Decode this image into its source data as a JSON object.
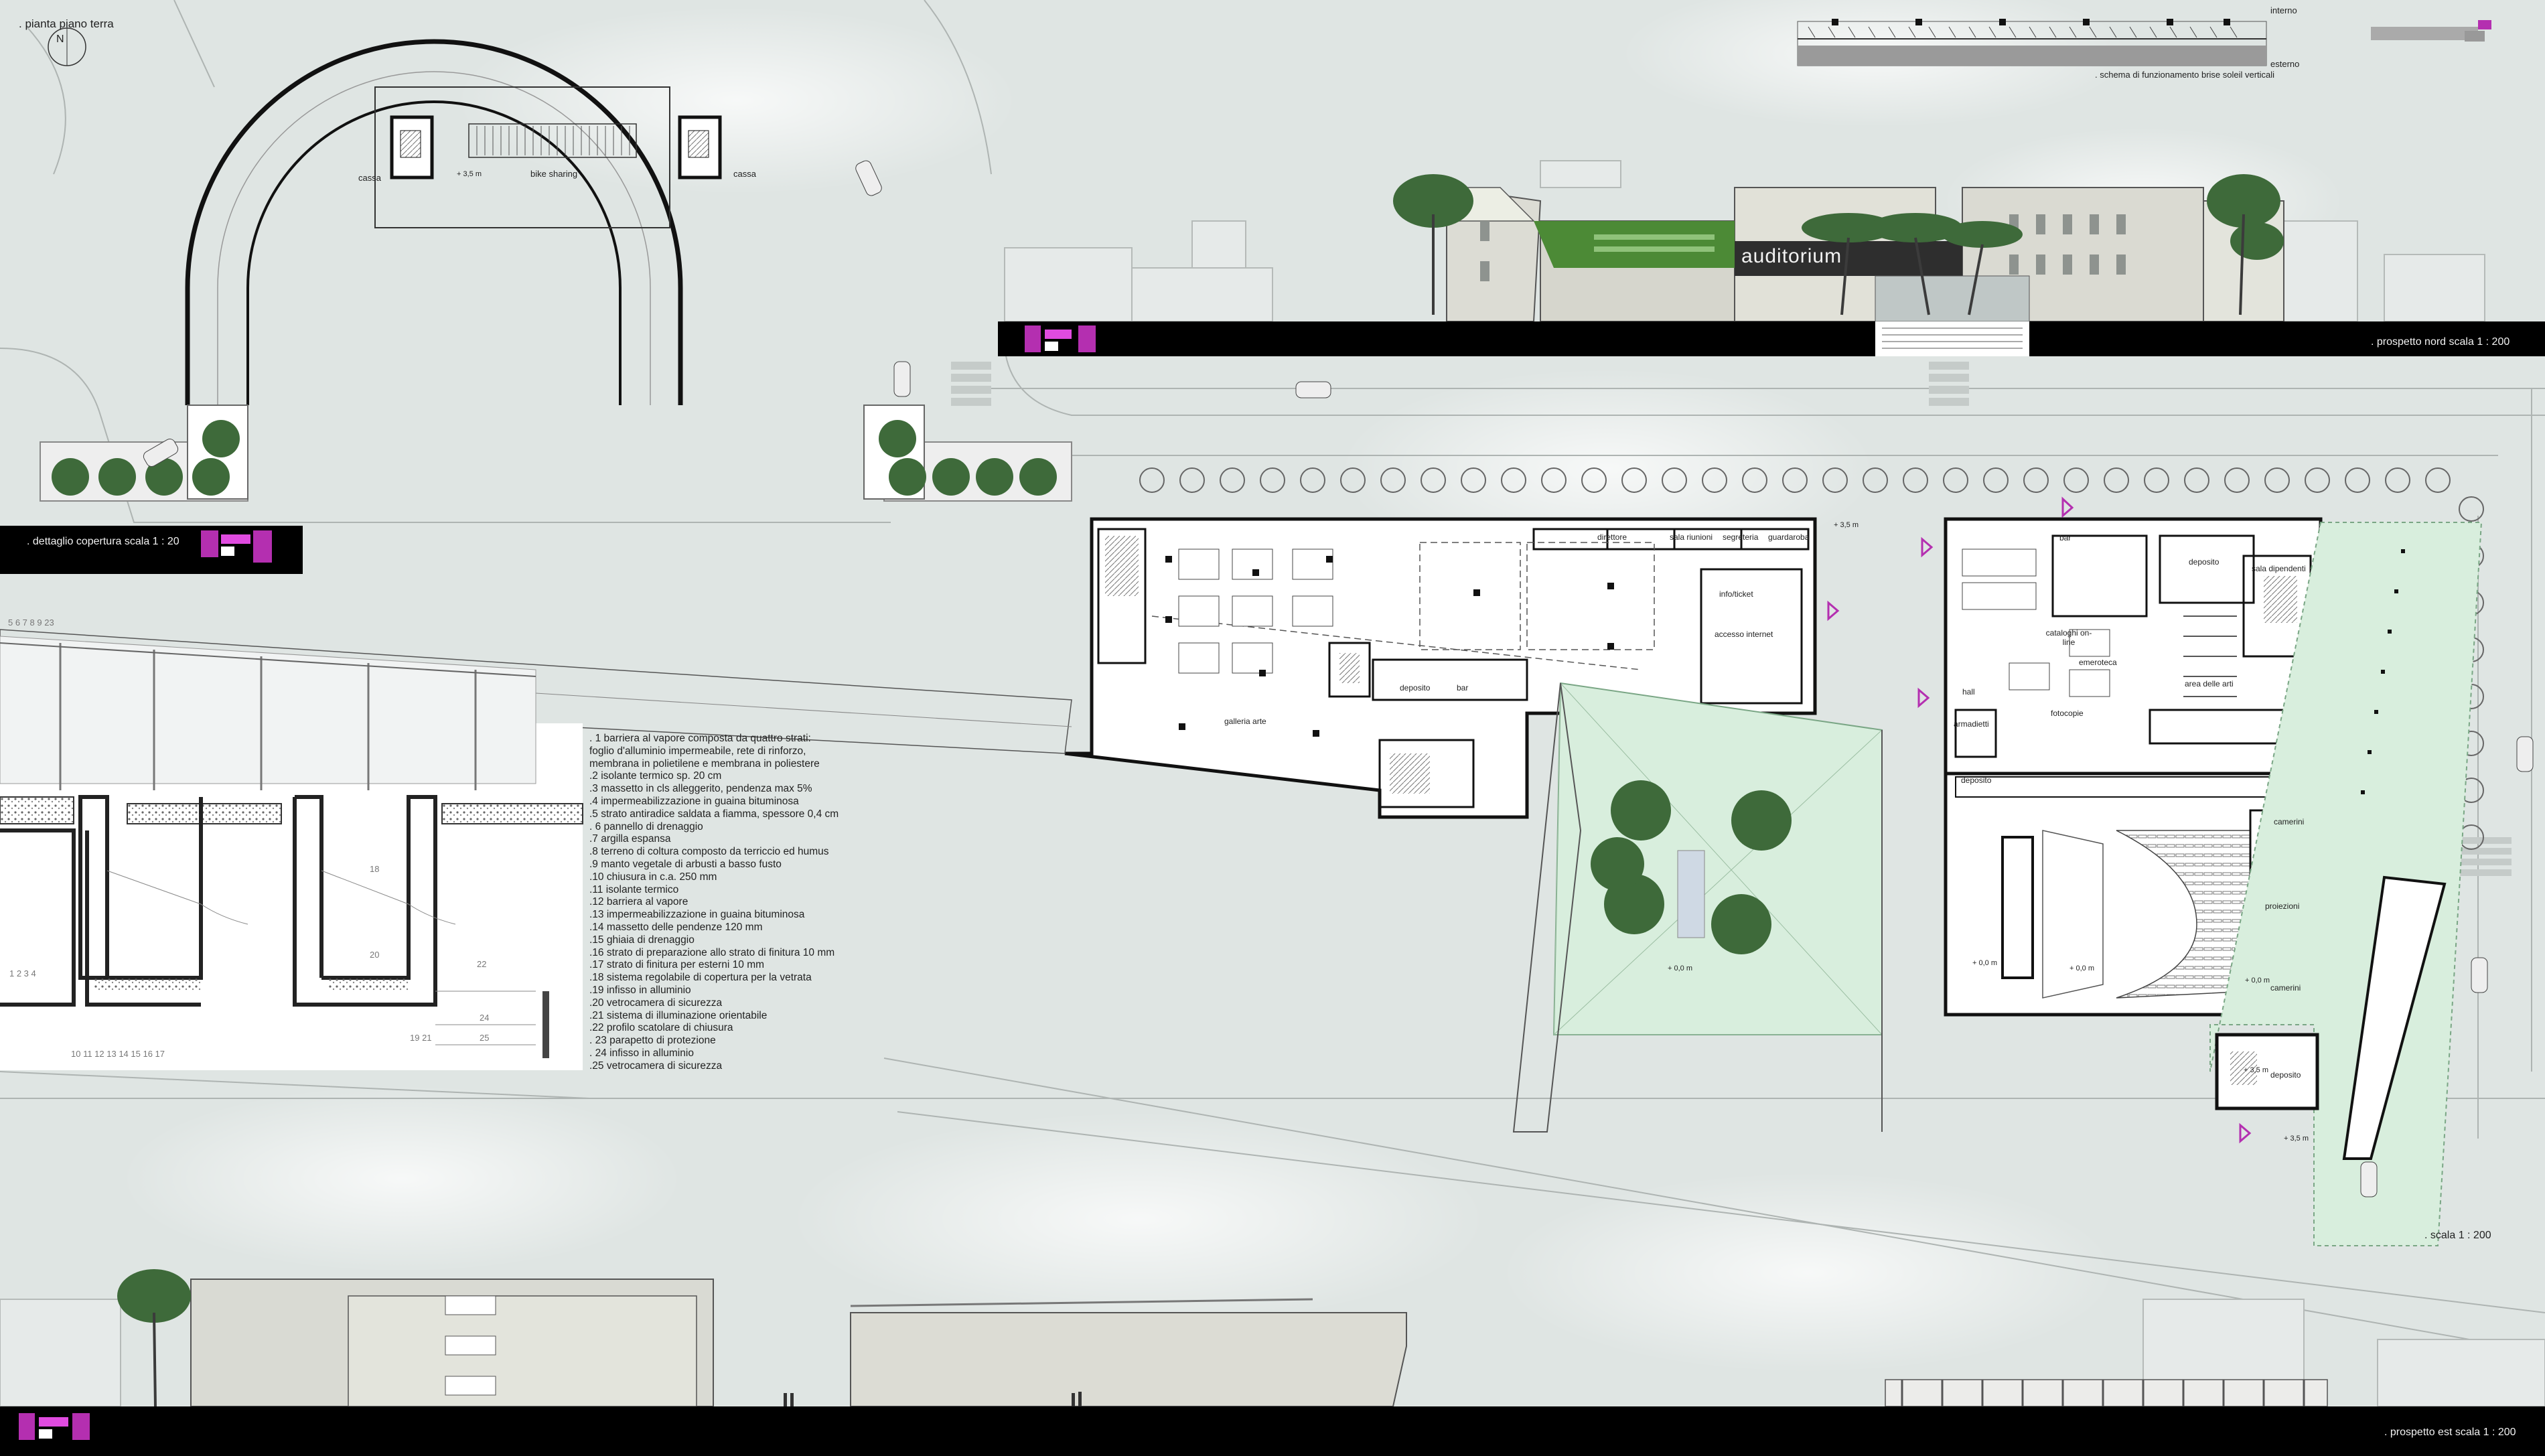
{
  "title": {
    "ground_floor_plan": ". pianta piano terra",
    "north_arrow": "N"
  },
  "scales": {
    "north_elevation": ". prospetto nord scala 1 : 200",
    "roof_detail": ". dettaglio copertura scala 1 : 20",
    "plan_scale": ". scala 1 : 200",
    "east_elevation": ". prospetto est scala 1 : 200"
  },
  "brise_soleil_schema": {
    "interior": "interno",
    "exterior": "esterno",
    "caption": ". schema di funzionamento brise soleil verticali"
  },
  "elevation_north": {
    "auditorium_sign": "auditorium"
  },
  "arch_pavilion": {
    "cassa_left": "cassa",
    "cassa_right": "cassa",
    "bike_sharing": "bike sharing",
    "level": "+ 3,5 m"
  },
  "rooms": {
    "direttore": "direttore",
    "sala_riunioni": "sala riunioni",
    "segreteria": "segreteria",
    "guardaroba": "guardaroba",
    "info_ticket": "info/ticket",
    "accesso_internet": "accesso internet",
    "galleria_arte": "galleria arte",
    "deposito_west": "deposito",
    "bar_west": "bar",
    "bar_east": "bar",
    "deposito_ne": "deposito",
    "sala_dipendenti": "sala dipendenti",
    "cataloghi": "cataloghi on-line",
    "emeroteca": "emeroteca",
    "area_arti": "area delle arti",
    "hall": "hall",
    "armadietti": "armadietti",
    "fotocopie": "fotocopie",
    "deposito_aud": "deposito",
    "camerini_top": "camerini",
    "proiezioni": "proiezioni",
    "camerini_bottom": "camerini",
    "deposito_se": "deposito"
  },
  "levels": {
    "entrance": "+ 3,5 m",
    "court": "+ 0,0 m",
    "aud_a": "+ 0,0 m",
    "aud_b": "+ 0,0 m",
    "aud_c": "+ 0,0 m",
    "south_b": "+ 3,5 m",
    "south_c": "+ 3,5 m"
  },
  "detail_numbers": {
    "top_row": "5 6 7 8 9 23",
    "left": "1 2 3 4",
    "bottom": "10 11 12 13 14 15 16 17",
    "n18": "18",
    "n20": "20",
    "n22": "22",
    "n24": "24",
    "n1921": "19 21",
    "n25": "25"
  },
  "legend": [
    ". 1 barriera al vapore composta da quattro strati:",
    "foglio d'alluminio impermeabile, rete di rinforzo,",
    "membrana in polietilene e membrana in poliestere",
    ".2 isolante termico sp. 20 cm",
    ".3 massetto in cls alleggerito, pendenza max 5%",
    ".4 impermeabilizzazione in guaina bituminosa",
    ".5 strato antiradice saldata a fiamma, spessore 0,4 cm",
    ". 6 pannello di drenaggio",
    ".7 argilla espansa",
    ".8 terreno di coltura composto da terriccio ed humus",
    ".9 manto vegetale di arbusti a basso fusto",
    ".10 chiusura in c.a. 250 mm",
    ".11 isolante termico",
    ".12 barriera al vapore",
    ".13 impermeabilizzazione in guaina bituminosa",
    ".14 massetto delle pendenze 120 mm",
    ".15 ghiaia di drenaggio",
    ".16 strato di preparazione allo strato di finitura 10 mm",
    ".17 strato di finitura per esterni 10 mm",
    ".18 sistema regolabile di copertura per la vetrata",
    ".19 infisso in alluminio",
    ".20 vetrocamera di sicurezza",
    ".21 sistema di illuminazione orientabile",
    ".22 profilo scatolare di chiusura",
    ". 23 parapetto di protezione",
    ". 24 infisso in alluminio",
    ".25 vetrocamera di sicurezza"
  ],
  "colors": {
    "background": "#dfe5e3",
    "accent_magenta": "#b42fb0",
    "plan_black": "#111111",
    "court_green": "#d8eedd",
    "tree_green": "#3e6a3a"
  }
}
